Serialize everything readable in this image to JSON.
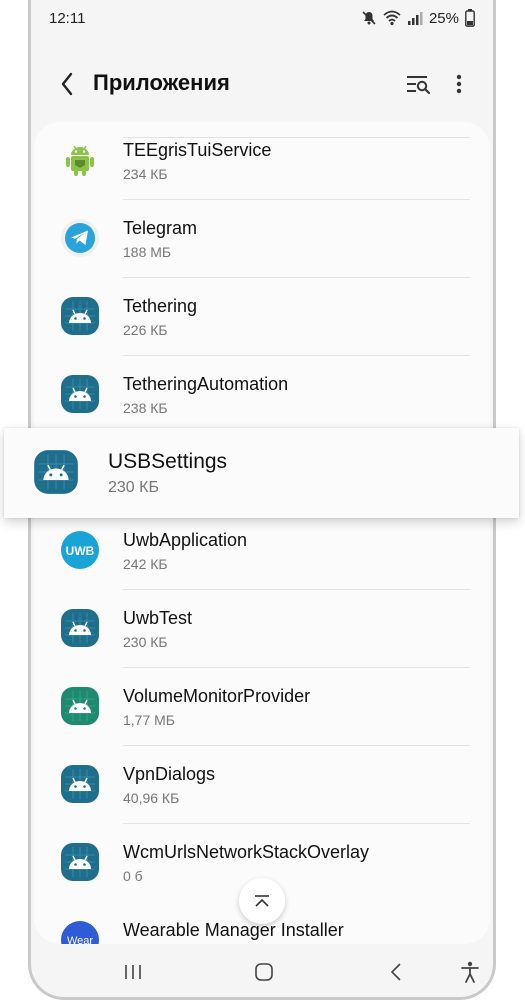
{
  "status_bar": {
    "time": "12:11",
    "battery": "25%",
    "icons": [
      "mute-icon",
      "wifi-icon",
      "signal-icon",
      "battery-icon"
    ]
  },
  "header": {
    "title": "Приложения",
    "icons": [
      "back-arrow-icon",
      "sort-search-icon",
      "more-options-icon"
    ]
  },
  "apps": [
    {
      "name": "TEEgrisTuiService",
      "size": "234 КБ",
      "icon": "android-green-icon"
    },
    {
      "name": "Telegram",
      "size": "188 МБ",
      "icon": "telegram-icon"
    },
    {
      "name": "Tethering",
      "size": "226 КБ",
      "icon": "android-system-icon"
    },
    {
      "name": "TetheringAutomation",
      "size": "238 КБ",
      "icon": "android-system-icon"
    },
    {
      "name": "USBSettings",
      "size": "230 КБ",
      "icon": "android-system-icon"
    },
    {
      "name": "UwbApplication",
      "size": "242 КБ",
      "icon": "uwb-icon",
      "icon_text": "UWB"
    },
    {
      "name": "UwbTest",
      "size": "230 КБ",
      "icon": "android-system-icon"
    },
    {
      "name": "VolumeMonitorProvider",
      "size": "1,77 МБ",
      "icon": "android-teal-icon"
    },
    {
      "name": "VpnDialogs",
      "size": "40,96 КБ",
      "icon": "android-system-icon"
    },
    {
      "name": "WcmUrlsNetworkStackOverlay",
      "size": "0 б",
      "icon": "android-system-icon"
    },
    {
      "name": "Wearable Manager Installer",
      "size": "",
      "icon": "wear-icon",
      "icon_text": "Wear"
    }
  ],
  "highlighted_index": 4,
  "controls": {
    "scroll_to_top": "chevron-up-icon",
    "fast_scroller": "fast-scroll-handle"
  },
  "navigation": [
    "recents-icon",
    "home-icon",
    "back-icon",
    "accessibility-icon"
  ],
  "colors": {
    "android_system_bg": "#1f6e8c",
    "android_teal_bg": "#1e8a6e",
    "telegram": "#2aa3db",
    "uwb": "#1aa3d6",
    "wear": "#2f5bd6",
    "android_green": "#8bc34a"
  }
}
